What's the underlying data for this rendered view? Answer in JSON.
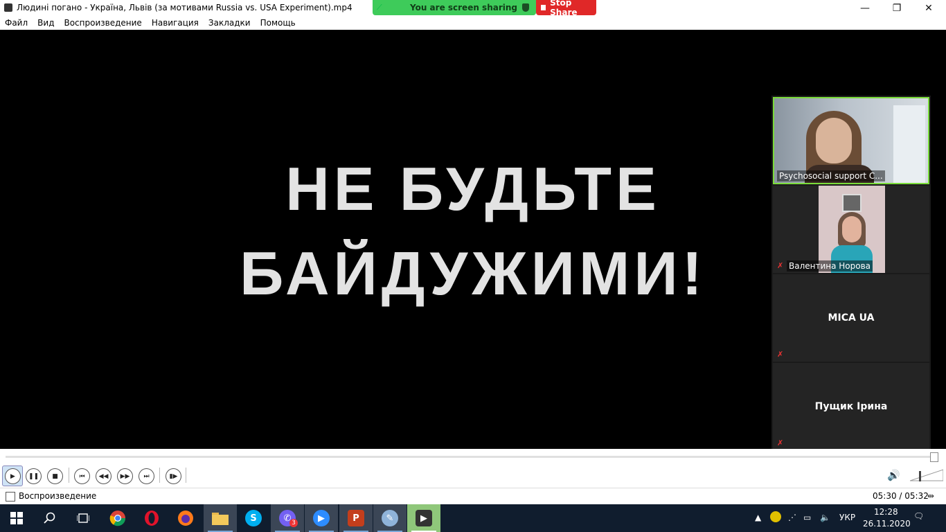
{
  "window": {
    "title": "Людині погано - Україна, Львів (за мотивами Russia vs. USA Experiment).mp4",
    "minimize": "—",
    "restore": "❐",
    "close": "✕"
  },
  "zoom_share": {
    "status": "You are screen sharing",
    "stop_label": "Stop Share",
    "color": "#3ecb5a",
    "stop_color": "#e02828"
  },
  "menu": [
    "Файл",
    "Вид",
    "Воспроизведение",
    "Навигация",
    "Закладки",
    "Помощь"
  ],
  "video": {
    "line1": "НЕ БУДЬТЕ",
    "line2": "БАЙДУЖИМИ!"
  },
  "participants": [
    {
      "name": "Psychosocial support C...",
      "video": true,
      "active_speaker": true
    },
    {
      "name": "Валентина Норова",
      "video": true,
      "muted": true
    },
    {
      "name": "MICA UA",
      "video": false,
      "muted": true
    },
    {
      "name": "Пущик Ірина",
      "video": false,
      "muted": true
    }
  ],
  "player": {
    "status": "Воспроизведение",
    "time": "05:30 / 05:32",
    "progress": 0.994
  },
  "taskbar": {
    "apps": [
      "windows-start",
      "search",
      "task-view",
      "chrome",
      "opera",
      "firefox",
      "file-explorer",
      "skype",
      "viber",
      "zoom",
      "powerpoint",
      "paint",
      "media-player-classic"
    ],
    "viber_badge": "3",
    "language": "УКР",
    "time": "12:28",
    "date": "26.11.2020"
  }
}
